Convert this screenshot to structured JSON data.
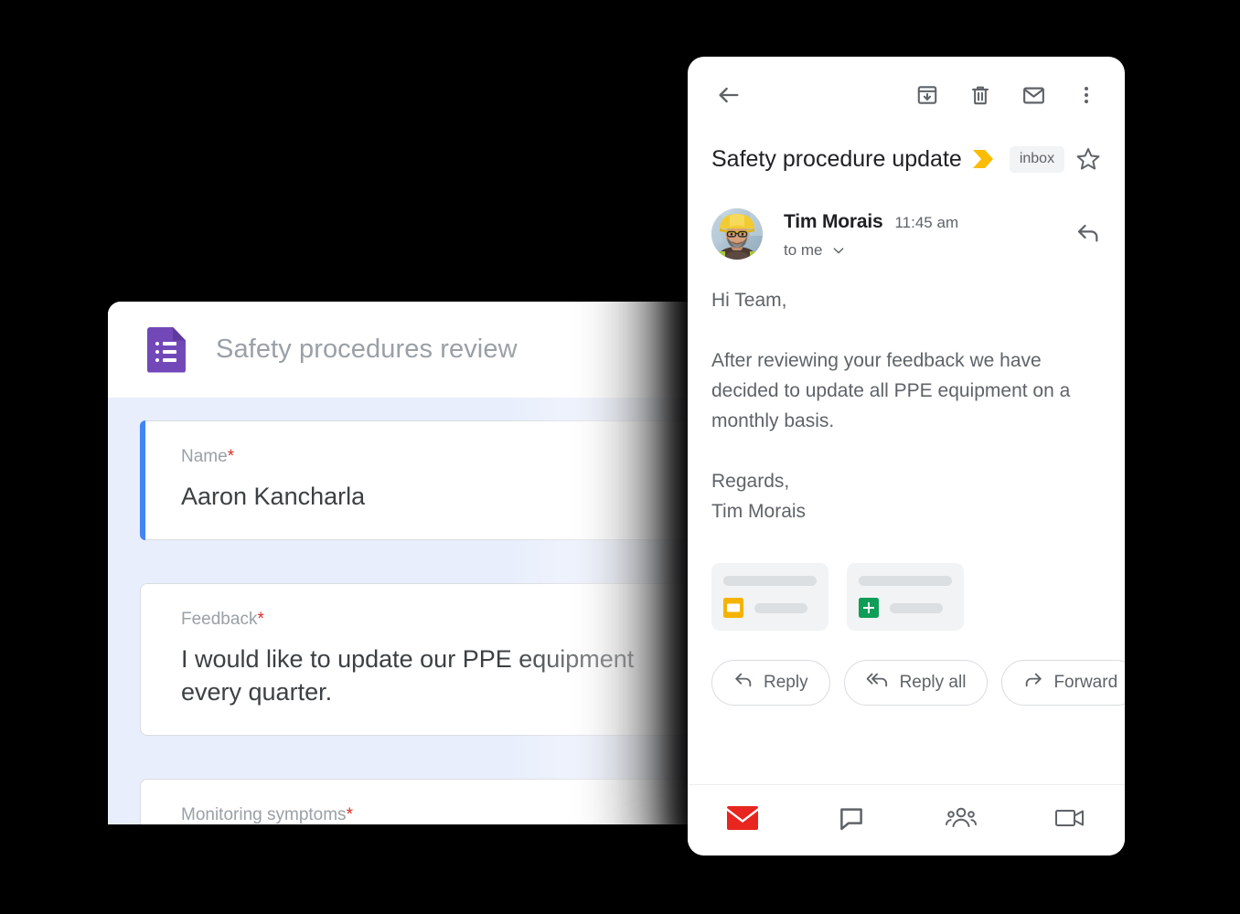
{
  "forms": {
    "app_icon": "google-forms-icon",
    "title": "Safety procedures review",
    "questions": [
      {
        "label": "Name",
        "required_marker": "*",
        "answer": "Aaron Kancharla",
        "focused": true
      },
      {
        "label": "Feedback",
        "required_marker": "*",
        "answer": "I would like to update our PPE equipment every quarter.",
        "focused": false
      },
      {
        "label": "Monitoring symptoms",
        "required_marker": "*",
        "answer": "",
        "focused": false
      }
    ],
    "colors": {
      "accent": "#4285f4",
      "background": "#e8eefc",
      "icon": "#7248b9",
      "required": "#d93025"
    }
  },
  "gmail": {
    "toolbar": {
      "back_icon": "back-arrow-icon",
      "archive_icon": "archive-icon",
      "delete_icon": "trash-icon",
      "mark_unread_icon": "envelope-icon",
      "more_icon": "more-vertical-icon"
    },
    "subject": "Safety procedure update",
    "label_chevron_icon": "yellow-chevron-icon",
    "label_chip": "inbox",
    "star_icon": "star-outline-icon",
    "message": {
      "sender_name": "Tim Morais",
      "time": "11:45 am",
      "recipient": "to me",
      "recipient_chevron_icon": "chevron-down-icon",
      "reply_icon": "reply-arrow-icon",
      "avatar": "avatar-photo-hardhat",
      "body": [
        "Hi Team,",
        "After reviewing your feedback we have decided to update all PPE equipment on a monthly basis.",
        "Regards,\nTim Morais"
      ]
    },
    "attachments": [
      {
        "icon": "google-slides-icon",
        "icon_color": "#f5b300"
      },
      {
        "icon": "google-sheets-icon",
        "icon_color": "#0f9d58"
      }
    ],
    "actions": [
      {
        "label": "Reply",
        "icon": "reply-icon"
      },
      {
        "label": "Reply all",
        "icon": "reply-all-icon"
      },
      {
        "label": "Forward",
        "icon": "forward-icon"
      }
    ],
    "bottom_nav": [
      {
        "icon": "mail-icon",
        "active": true,
        "color": "#e8251f"
      },
      {
        "icon": "chat-icon",
        "active": false
      },
      {
        "icon": "spaces-people-icon",
        "active": false
      },
      {
        "icon": "meet-video-icon",
        "active": false
      }
    ],
    "colors": {
      "icon": "#5f6368",
      "text": "#202124",
      "secondary_text": "#5f6368",
      "mail_red": "#e8251f",
      "chip_bg": "#f1f3f4"
    }
  }
}
